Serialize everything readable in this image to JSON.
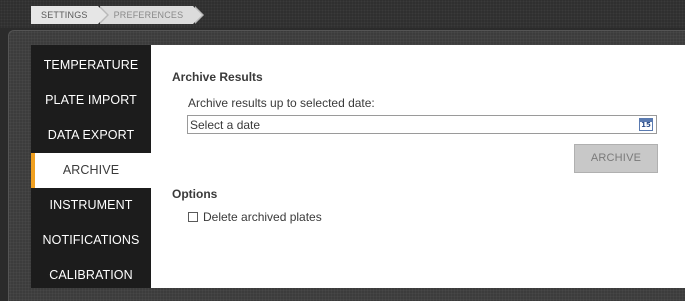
{
  "breadcrumb": {
    "items": [
      "SETTINGS",
      "PREFERENCES"
    ]
  },
  "sidebar": {
    "items": [
      {
        "label": "TEMPERATURE",
        "active": false
      },
      {
        "label": "PLATE IMPORT",
        "active": false
      },
      {
        "label": "DATA EXPORT",
        "active": false
      },
      {
        "label": "ARCHIVE",
        "active": true
      },
      {
        "label": "INSTRUMENT",
        "active": false
      },
      {
        "label": "NOTIFICATIONS",
        "active": false
      },
      {
        "label": "CALIBRATION",
        "active": false
      }
    ]
  },
  "archive": {
    "title": "Archive Results",
    "date_label": "Archive results up to selected date:",
    "date_placeholder": "Select a date",
    "date_value": "",
    "calendar_icon": "calendar-icon",
    "calendar_day": "15",
    "button_label": "ARCHIVE"
  },
  "options": {
    "title": "Options",
    "delete_label": "Delete archived plates",
    "delete_checked": false
  },
  "colors": {
    "accent": "#f0a020",
    "sidebar_bg": "#1c1c1c",
    "button_disabled": "#c8c8c8"
  }
}
